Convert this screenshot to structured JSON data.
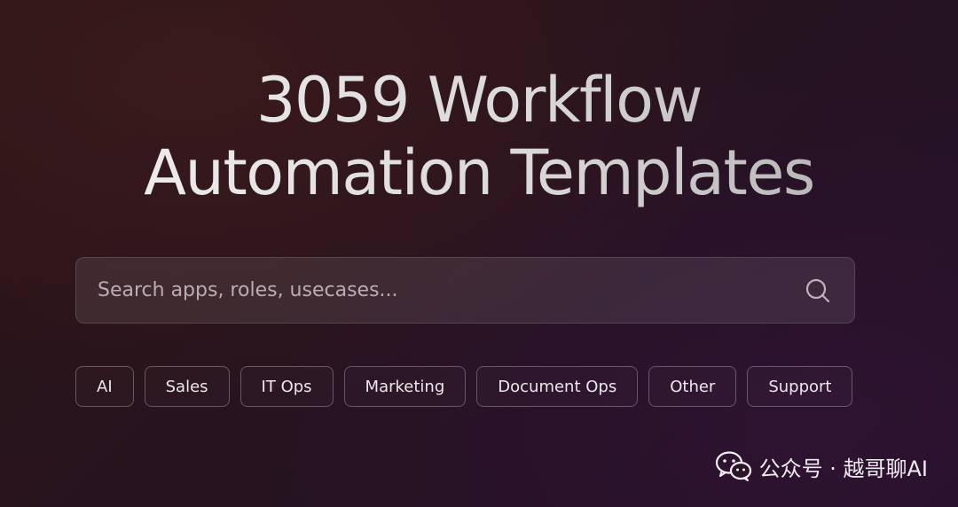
{
  "hero": {
    "title_line1": "3059 Workflow",
    "title_line2": "Automation Templates"
  },
  "search": {
    "placeholder": "Search apps, roles, usecases...",
    "value": "",
    "icon": "search-icon"
  },
  "categories": [
    {
      "label": "AI"
    },
    {
      "label": "Sales"
    },
    {
      "label": "IT Ops"
    },
    {
      "label": "Marketing"
    },
    {
      "label": "Document Ops"
    },
    {
      "label": "Other"
    },
    {
      "label": "Support"
    }
  ],
  "watermark": {
    "icon": "wechat-icon",
    "text": "公众号 · 越哥聊AI"
  },
  "colors": {
    "background": "#26131e",
    "title": "#dcdcdc",
    "chip_border": "#5a4a52",
    "search_bg": "#3e2a36"
  }
}
